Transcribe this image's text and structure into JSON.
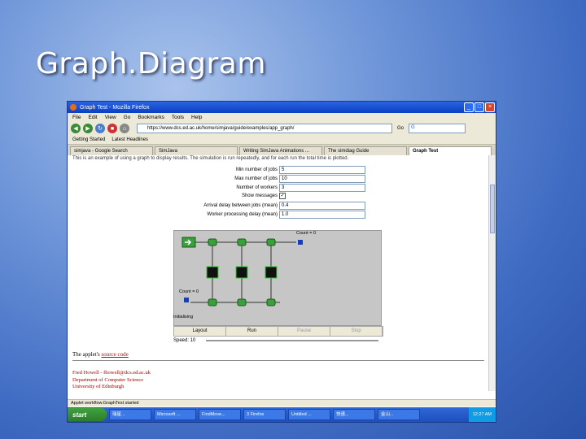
{
  "slide": {
    "title": "Graph.Diagram"
  },
  "window": {
    "title": "Graph Test - Mozilla Firefox"
  },
  "menu": [
    "File",
    "Edit",
    "View",
    "Go",
    "Bookmarks",
    "Tools",
    "Help"
  ],
  "nav": {
    "url": "https://www.dcs.ed.ac.uk/home/simjava/guide/examples/app_graph/",
    "go": "Go",
    "search_label": "G"
  },
  "bookmarks": [
    "Getting Started",
    "Latest Headlines"
  ],
  "tabs": [
    "simjava - Google Search",
    "SimJava",
    "Writing SimJava Animations ...",
    "The simdiag Guide",
    "Graph Test"
  ],
  "page": {
    "intro": "This is an example of using a graph to display results. The simulation is run repeatedly, and for each run the total time is plotted.",
    "form": [
      {
        "label": "Min number of jobs",
        "value": "5"
      },
      {
        "label": "Max number of jobs",
        "value": "10"
      },
      {
        "label": "Number of workers",
        "value": "3"
      },
      {
        "label": "Show messages",
        "value": "✓"
      },
      {
        "label": "Arrival delay between jobs (mean)",
        "value": "0.4"
      },
      {
        "label": "Worker processing delay (mean)",
        "value": "1.0"
      }
    ],
    "sim": {
      "count_top": "Count = 0",
      "count_bottom": "Count = 0",
      "status": "Initialising"
    },
    "controls": {
      "layout": "Layout",
      "run": "Run",
      "pause": "Pause",
      "stop": "Stop"
    },
    "speed": "Speed: 10",
    "source_prefix": "The applet's ",
    "source_link": "source code",
    "author": {
      "name": "Fred Howell - fhowell@dcs.ed.ac.uk",
      "dept": "Department of Computer Science",
      "univ": "University of Edinburgh"
    }
  },
  "statusbar": "Applet workflow.GraphTest started",
  "taskbar": {
    "start": "start",
    "tasks": [
      "瑞星...",
      "Microsoft ...",
      "FindMove...",
      "3 Firefox",
      "Untitled ...",
      "快速...",
      "金山..."
    ],
    "clock": "12:27 AM"
  },
  "colors": {
    "link": "#cc0000",
    "worker": "#111111",
    "station": "#3ba03b",
    "counter": "#1040c0"
  }
}
